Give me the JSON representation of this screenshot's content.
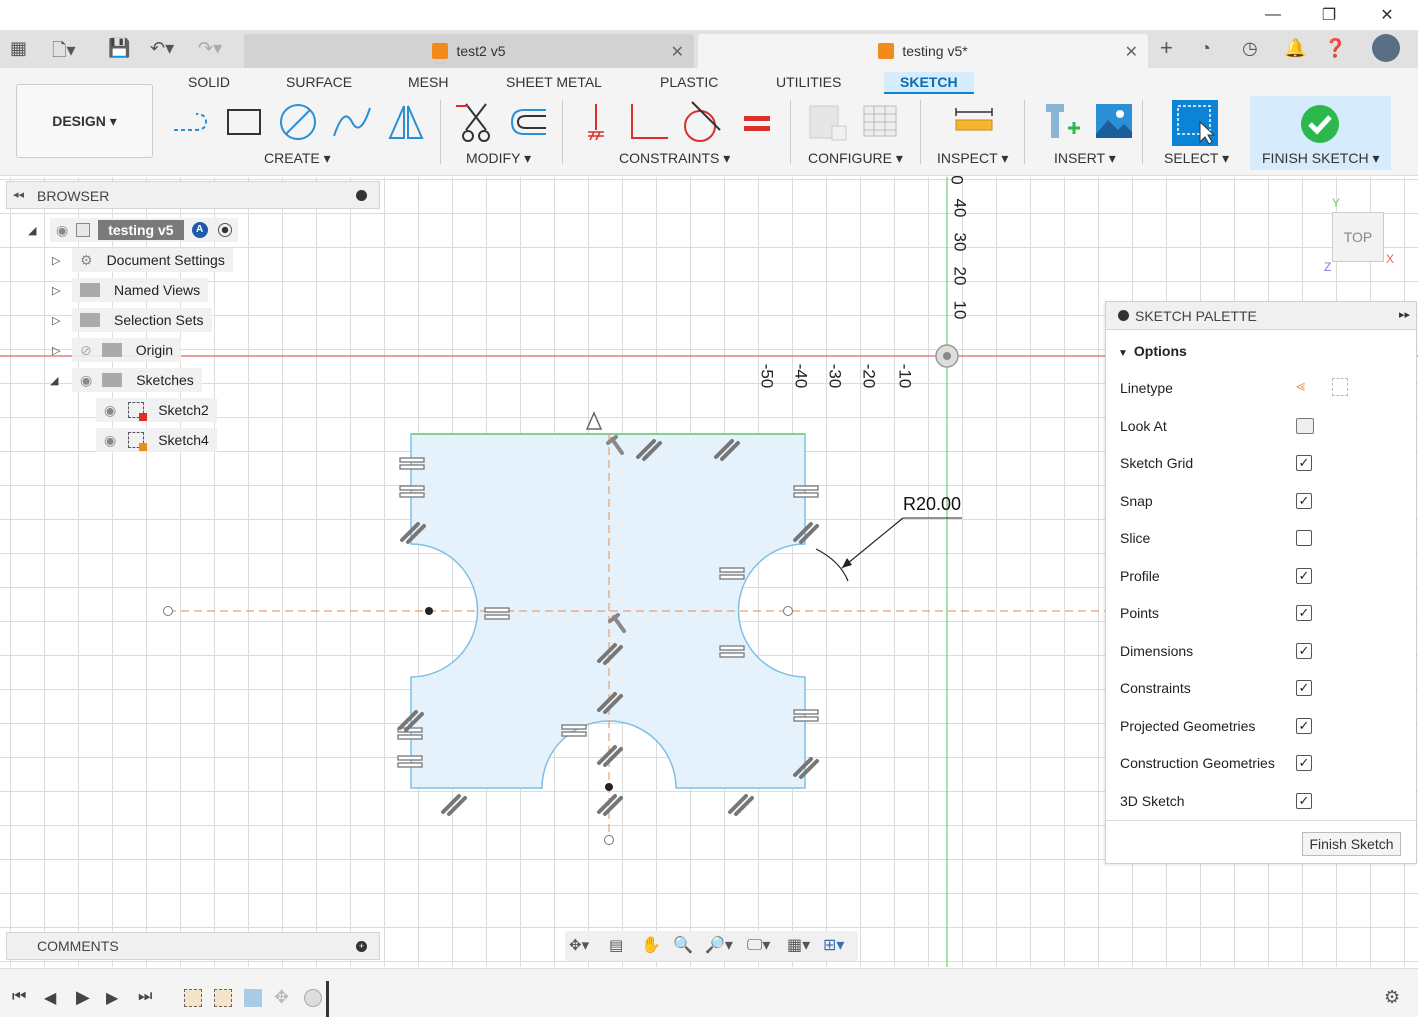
{
  "window": {
    "minimize": "—",
    "restore": "❐",
    "close": "✕"
  },
  "tabs": [
    {
      "label": "test2 v5",
      "close": "✕"
    },
    {
      "label": "testing v5*",
      "close": "✕"
    }
  ],
  "ribbon_tabs": [
    "SOLID",
    "SURFACE",
    "MESH",
    "SHEET METAL",
    "PLASTIC",
    "UTILITIES",
    "SKETCH"
  ],
  "active_ribbon_tab": "SKETCH",
  "workspace": "DESIGN ▾",
  "groups": {
    "create": "CREATE ▾",
    "modify": "MODIFY ▾",
    "constraints": "CONSTRAINTS ▾",
    "configure": "CONFIGURE ▾",
    "inspect": "INSPECT ▾",
    "insert": "INSERT ▾",
    "select": "SELECT ▾",
    "finish": "FINISH SKETCH ▾"
  },
  "browser": {
    "title": "BROWSER",
    "root": "testing v5",
    "items": [
      "Document Settings",
      "Named Views",
      "Selection Sets",
      "Origin",
      "Sketches"
    ],
    "sketches": [
      "Sketch2",
      "Sketch4"
    ]
  },
  "axis": {
    "vertical_ticks": [
      "0",
      "40",
      "30",
      "20",
      "10"
    ],
    "horizontal_ticks": [
      "-50",
      "-40",
      "-30",
      "-20",
      "-10"
    ]
  },
  "dimension": "R20.00",
  "viewcube": {
    "face": "TOP",
    "axis_y": "Y",
    "axis_z": "Z",
    "axis_x": "X"
  },
  "palette": {
    "title": "SKETCH PALETTE",
    "section": "Options",
    "options": [
      {
        "label": "Linetype",
        "type": "icon"
      },
      {
        "label": "Look At",
        "type": "icon"
      },
      {
        "label": "Sketch Grid",
        "checked": true
      },
      {
        "label": "Snap",
        "checked": true
      },
      {
        "label": "Slice",
        "checked": false
      },
      {
        "label": "Profile",
        "checked": true
      },
      {
        "label": "Points",
        "checked": true
      },
      {
        "label": "Dimensions",
        "checked": true
      },
      {
        "label": "Constraints",
        "checked": true
      },
      {
        "label": "Projected Geometries",
        "checked": true
      },
      {
        "label": "Construction Geometries",
        "checked": true
      },
      {
        "label": "3D Sketch",
        "checked": true
      }
    ],
    "finish_button": "Finish Sketch"
  },
  "comments": {
    "title": "COMMENTS"
  },
  "colors": {
    "accent": "#0b84d8",
    "sketch_fill": "#e6f2fb",
    "sketch_line": "#7fbfe6",
    "x_axis": "#e06666",
    "y_axis": "#6fcf6f",
    "construction": "#e8a070",
    "check_green": "#2db84d"
  }
}
